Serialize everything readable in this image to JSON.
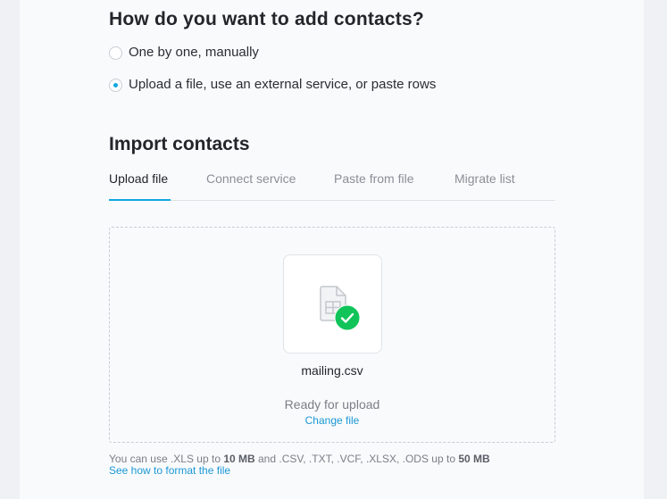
{
  "question": {
    "title": "How do you want to add contacts?",
    "options": [
      {
        "label": "One by one, manually",
        "selected": false
      },
      {
        "label": "Upload a file, use an external service, or paste rows",
        "selected": true
      }
    ]
  },
  "import": {
    "title": "Import contacts",
    "tabs": [
      {
        "label": "Upload file",
        "active": true
      },
      {
        "label": "Connect service",
        "active": false
      },
      {
        "label": "Paste from file",
        "active": false
      },
      {
        "label": "Migrate list",
        "active": false
      }
    ]
  },
  "upload": {
    "file_icon": "spreadsheet-file-icon",
    "status_icon": "checkmark-icon",
    "file_name": "mailing.csv",
    "status": "Ready for upload",
    "change_link": "Change file"
  },
  "hint": {
    "part1": "You can use .XLS up to ",
    "size1": "10 MB",
    "part2": " and .CSV, .TXT, .VCF, .XLSX, .ODS up to ",
    "size2": "50 MB",
    "format_link": "See how to format the file"
  },
  "colors": {
    "accent": "#11a6e1",
    "success": "#10c45a",
    "link": "#1a98d5"
  }
}
